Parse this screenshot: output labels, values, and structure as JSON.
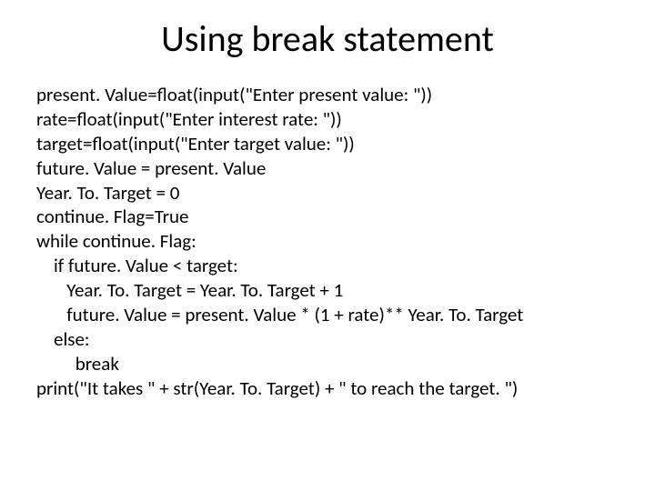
{
  "title": "Using break statement",
  "code": {
    "l0": "present. Value=float(input(\"Enter present value: \"))",
    "l1": "rate=float(input(\"Enter interest rate: \"))",
    "l2": "target=float(input(\"Enter target value: \"))",
    "l3": "future. Value = present. Value",
    "l4": "Year. To. Target = 0",
    "l5": "continue. Flag=True",
    "l6": "while continue. Flag:",
    "l7": "    if future. Value < target:",
    "l8": "       Year. To. Target = Year. To. Target + 1",
    "l9": "       future. Value = present. Value * (1 + rate)** Year. To. Target",
    "l10": "    else:",
    "l11": "         break",
    "l12": "print(\"It takes \" + str(Year. To. Target) + \" to reach the target. \")"
  }
}
